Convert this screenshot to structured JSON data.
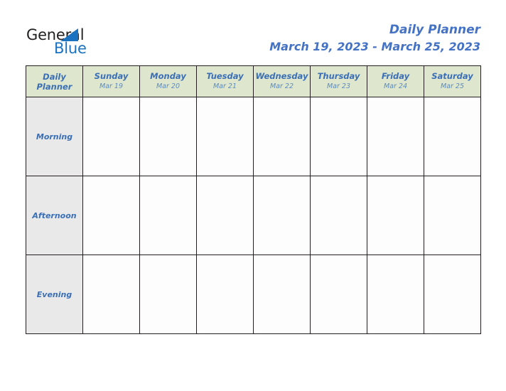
{
  "brand": {
    "name_part1": "General",
    "name_part2": "Blue",
    "triangle_icon": "blue-triangle-logo-mark",
    "accent_color": "#1a72c0",
    "text_color": "#221f1f"
  },
  "header": {
    "title": "Daily Planner",
    "date_range": "March 19, 2023 - March 25, 2023",
    "title_color": "#4472c4"
  },
  "table": {
    "corner_label_line1": "Daily",
    "corner_label_line2": "Planner",
    "header_bg": "#dee7cd",
    "row_label_bg": "#e9e9e9",
    "cell_bg": "#fdfdfd",
    "border_color": "#231f20",
    "header_text_color": "#3a6fb8",
    "columns": [
      {
        "day": "Sunday",
        "date": "Mar 19"
      },
      {
        "day": "Monday",
        "date": "Mar 20"
      },
      {
        "day": "Tuesday",
        "date": "Mar 21"
      },
      {
        "day": "Wednesday",
        "date": "Mar 22"
      },
      {
        "day": "Thursday",
        "date": "Mar 23"
      },
      {
        "day": "Friday",
        "date": "Mar 24"
      },
      {
        "day": "Saturday",
        "date": "Mar 25"
      }
    ],
    "rows": [
      {
        "label": "Morning",
        "cells": [
          "",
          "",
          "",
          "",
          "",
          "",
          ""
        ]
      },
      {
        "label": "Afternoon",
        "cells": [
          "",
          "",
          "",
          "",
          "",
          "",
          ""
        ]
      },
      {
        "label": "Evening",
        "cells": [
          "",
          "",
          "",
          "",
          "",
          "",
          ""
        ]
      }
    ]
  }
}
